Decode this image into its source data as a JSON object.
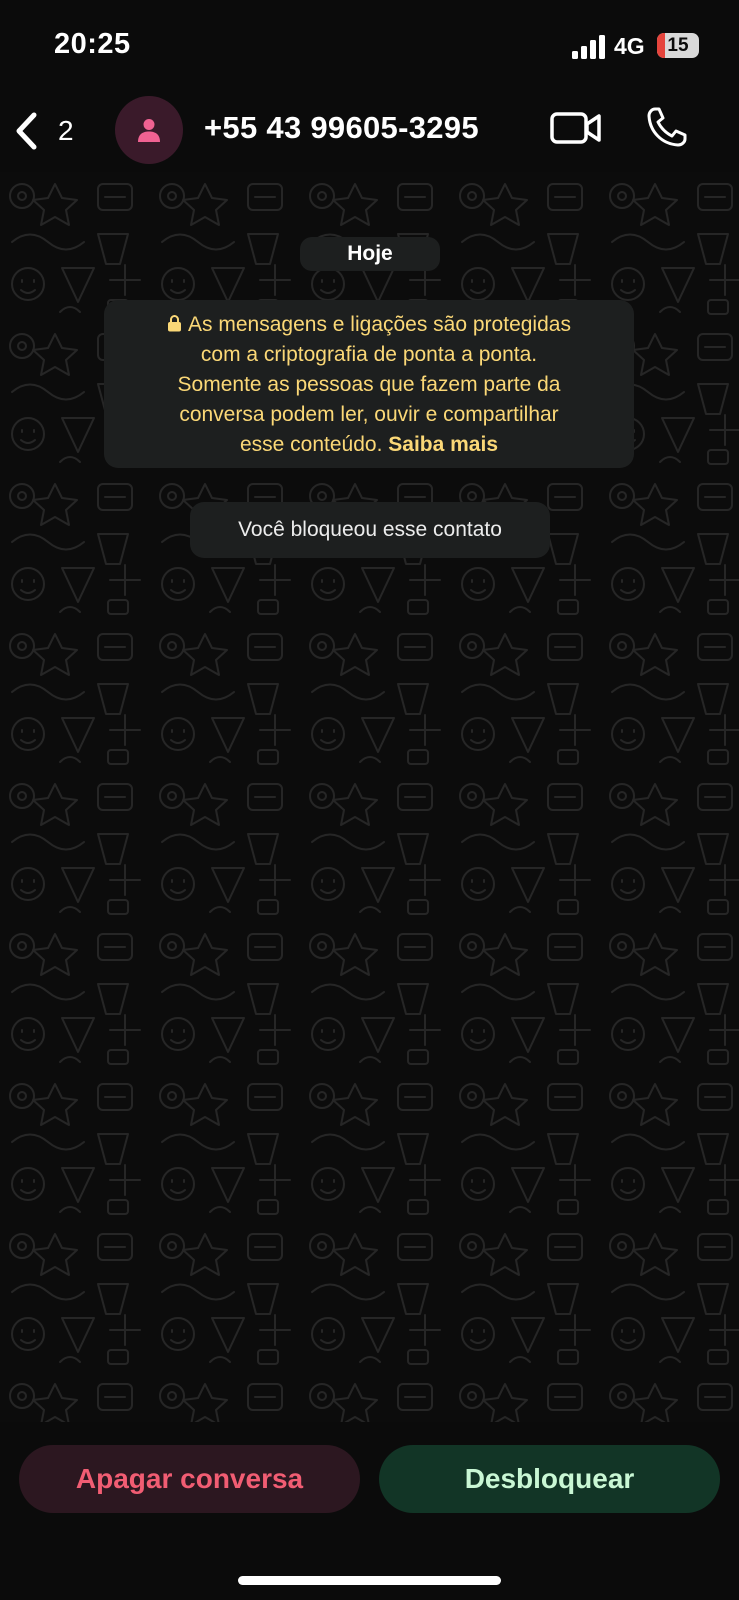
{
  "status_bar": {
    "time": "20:25",
    "network": "4G",
    "battery": "15",
    "signal_icon": "signal-bars-icon"
  },
  "header": {
    "back_count": "2",
    "contact_name": "+55 43 99605-3295",
    "icons": {
      "back": "chevron-left-icon",
      "avatar": "person-icon",
      "video": "video-camera-icon",
      "phone": "phone-icon"
    }
  },
  "chat": {
    "date_label": "Hoje",
    "encryption_notice": {
      "line1": "As mensagens e ligações são protegidas",
      "line2": "com a criptografia de ponta a ponta.",
      "line3": "Somente as pessoas que fazem parte da",
      "line4": "conversa podem ler, ouvir e compartilhar",
      "line5_prefix": "esse conteúdo. ",
      "learn_more": "Saiba mais",
      "icon": "lock-icon"
    },
    "blocked_notice": "Você bloqueou esse contato"
  },
  "actions": {
    "delete_label": "Apagar conversa",
    "unblock_label": "Desbloquear"
  },
  "colors": {
    "background": "#0b0b0b",
    "notice_text": "#fbd877",
    "delete_text": "#f15d73",
    "delete_bg": "#2c1720",
    "unblock_text": "#c9f7d4",
    "unblock_bg": "#123526"
  }
}
